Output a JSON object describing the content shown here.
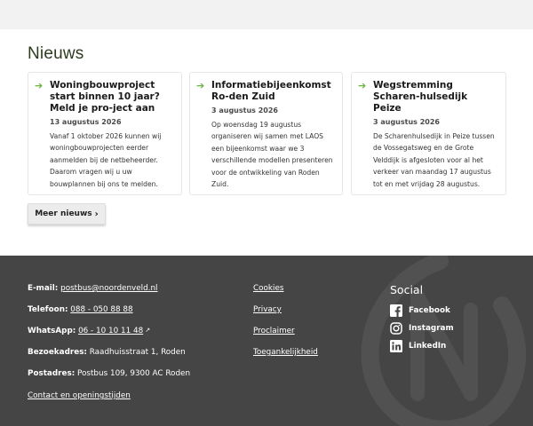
{
  "news": {
    "title": "Nieuws",
    "cards": [
      {
        "title": "Woningbouwproject start binnen 10 jaar? Meld je pro-ject aan",
        "date": "13 augustus 2026",
        "excerpt": "Vanaf 1 oktober 2026 kunnen wij woningbouwprojecten eerder aanmelden bij de netbeheerder. Daarom vragen wij u uw bouwplannen bij ons te melden."
      },
      {
        "title": "Informatiebijeenkomst Ro-den Zuid",
        "date": "3 augustus 2026",
        "excerpt": "Op woensdag 19 augustus organiseren wij samen met LAOS een bijeenkomst waar we 3 verschillende modellen presenteren voor de ontwikkeling van Roden Zuid."
      },
      {
        "title": "Wegstremming Scharen-hulsedijk Peize",
        "date": "3 augustus 2026",
        "excerpt": "De Scharenhulsedijk in Peize tussen de Vossegatsweg en de Grote Velddijk is afgesloten voor al het verkeer van maandag 17 augustus tot en met vrijdag 28 augustus."
      }
    ],
    "more_label": "Meer nieuws",
    "more_chevron": "›"
  },
  "footer": {
    "email_label": "E-mail:",
    "email_value": "postbus@noordenveld.nl",
    "phone_label": "Telefoon:",
    "phone_value": "088 - 050 88 88",
    "whatsapp_label": "WhatsApp:",
    "whatsapp_value": "06 - 10 10 11 48",
    "visit_label": "Bezoekadres:",
    "visit_value": "Raadhuisstraat 1, Roden",
    "post_label": "Postadres:",
    "post_value": "Postbus 109, 9300 AC Roden",
    "contact_link": "Contact en openingstijden",
    "links": [
      "Cookies",
      "Privacy",
      "Proclaimer",
      "Toegankelijkheid"
    ],
    "social_title": "Social",
    "social": [
      {
        "label": "Facebook",
        "icon": "facebook-icon"
      },
      {
        "label": "Instagram",
        "icon": "instagram-icon"
      },
      {
        "label": "LinkedIn",
        "icon": "linkedin-icon"
      }
    ]
  },
  "colors": {
    "accent_green": "#6cb33f",
    "footer_bg": "#454545",
    "page_bg": "#f2f2f2"
  }
}
